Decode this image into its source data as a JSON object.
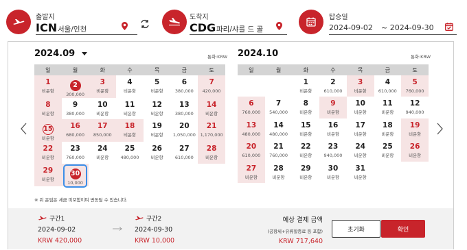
{
  "departure": {
    "label": "출발지",
    "code": "ICN",
    "city": "서울/인천"
  },
  "arrival": {
    "label": "도착지",
    "code": "CDG",
    "city": "파리/샤를 드 골"
  },
  "dates": {
    "label": "탑승일",
    "start": "2024-09-02",
    "end": "~ 2024-09-30"
  },
  "weekdays": [
    "일",
    "월",
    "화",
    "수",
    "목",
    "금",
    "토"
  ],
  "left_calendar": {
    "title": "2024.09",
    "currency": "통화:KRW",
    "weeks": [
      [
        {
          "d": "1",
          "p": "비운항"
        },
        {
          "d": "2",
          "p": "300,000",
          "sel": true
        },
        {
          "d": "3",
          "p": "비운항"
        },
        {
          "d": "4",
          "p": "비운항"
        },
        {
          "d": "5",
          "p": "비운항"
        },
        {
          "d": "6",
          "p": "380,000"
        },
        {
          "d": "7",
          "p": "420,000"
        }
      ],
      [
        {
          "d": "8",
          "p": "비운항"
        },
        {
          "d": "9",
          "p": "380,000"
        },
        {
          "d": "10",
          "p": "비운항"
        },
        {
          "d": "11",
          "p": "비운항"
        },
        {
          "d": "12",
          "p": "비운항"
        },
        {
          "d": "13",
          "p": "380,000"
        },
        {
          "d": "14",
          "p": "비운항"
        }
      ],
      [
        {
          "d": "15",
          "p": "비운항",
          "hol": true
        },
        {
          "d": "16",
          "p": "680,000"
        },
        {
          "d": "17",
          "p": "850,000"
        },
        {
          "d": "18",
          "p": "비운항"
        },
        {
          "d": "19",
          "p": "비운항"
        },
        {
          "d": "20",
          "p": "1,050,000"
        },
        {
          "d": "21",
          "p": "1,170,000"
        }
      ],
      [
        {
          "d": "22",
          "p": "비운항"
        },
        {
          "d": "23",
          "p": "760,000"
        },
        {
          "d": "24",
          "p": "비운항"
        },
        {
          "d": "25",
          "p": "480,000"
        },
        {
          "d": "26",
          "p": "비운항"
        },
        {
          "d": "27",
          "p": "610,000"
        },
        {
          "d": "28",
          "p": "비운항"
        }
      ],
      [
        {
          "d": "29",
          "p": "비운항"
        },
        {
          "d": "30",
          "p": "10,000",
          "sel": true,
          "boxed": true
        },
        null,
        null,
        null,
        null,
        null
      ]
    ]
  },
  "right_calendar": {
    "title": "2024.10",
    "currency": "통화:KRW",
    "weeks": [
      [
        null,
        null,
        {
          "d": "1",
          "p": "비운항"
        },
        {
          "d": "2",
          "p": "610,000"
        },
        {
          "d": "3",
          "p": "비운항"
        },
        {
          "d": "4",
          "p": "610,000"
        },
        {
          "d": "5",
          "p": "760,000"
        }
      ],
      [
        {
          "d": "6",
          "p": "760,000"
        },
        {
          "d": "7",
          "p": "540,000"
        },
        {
          "d": "8",
          "p": "비운항"
        },
        {
          "d": "9",
          "p": "비운항"
        },
        {
          "d": "10",
          "p": "비운항"
        },
        {
          "d": "11",
          "p": "비운항"
        },
        {
          "d": "12",
          "p": "940,000"
        }
      ],
      [
        {
          "d": "13",
          "p": "480,000"
        },
        {
          "d": "14",
          "p": "480,000"
        },
        {
          "d": "15",
          "p": "비운항"
        },
        {
          "d": "16",
          "p": "비운항"
        },
        {
          "d": "17",
          "p": "비운항"
        },
        {
          "d": "18",
          "p": "비운항"
        },
        {
          "d": "19",
          "p": "비운항"
        }
      ],
      [
        {
          "d": "20",
          "p": "610,000"
        },
        {
          "d": "21",
          "p": "760,000"
        },
        {
          "d": "22",
          "p": "비운항"
        },
        {
          "d": "23",
          "p": "940,000"
        },
        {
          "d": "24",
          "p": "비운항"
        },
        {
          "d": "25",
          "p": "비운항"
        },
        {
          "d": "26",
          "p": "비운항"
        }
      ],
      [
        {
          "d": "27",
          "p": "비운항"
        },
        {
          "d": "28",
          "p": "비운항"
        },
        {
          "d": "29",
          "p": "비운항"
        },
        {
          "d": "30",
          "p": "비운항"
        },
        {
          "d": "31",
          "p": "비운항"
        },
        null,
        null
      ]
    ]
  },
  "red_dates": {
    "left": [
      "1",
      "2",
      "3",
      "7",
      "8",
      "14",
      "15",
      "16",
      "17",
      "18",
      "21",
      "22",
      "28",
      "29",
      "30"
    ],
    "right": [
      "3",
      "5",
      "6",
      "9",
      "13",
      "19",
      "20",
      "26",
      "27"
    ]
  },
  "note": "※ 위 운임은 세금 미포함이며 변동될 수 있습니다.",
  "footer": {
    "seg1": {
      "label": "구간1",
      "date": "2024-09-02",
      "price": "KRW 420,000"
    },
    "seg2": {
      "label": "구간2",
      "date": "2024-09-30",
      "price": "KRW 10,000"
    },
    "estimate_label": "예상 결제 금액",
    "estimate_note": "(공항세+유류할증료 등 포함)",
    "estimate_price": "KRW 717,640",
    "reset_label": "초기화",
    "confirm_label": "확인"
  },
  "colors": {
    "brand": "#c8242b",
    "highlight_box": "#3b8ee8",
    "weekend_bg": "#f6e4e4",
    "header_bg": "#d4d4d4"
  }
}
